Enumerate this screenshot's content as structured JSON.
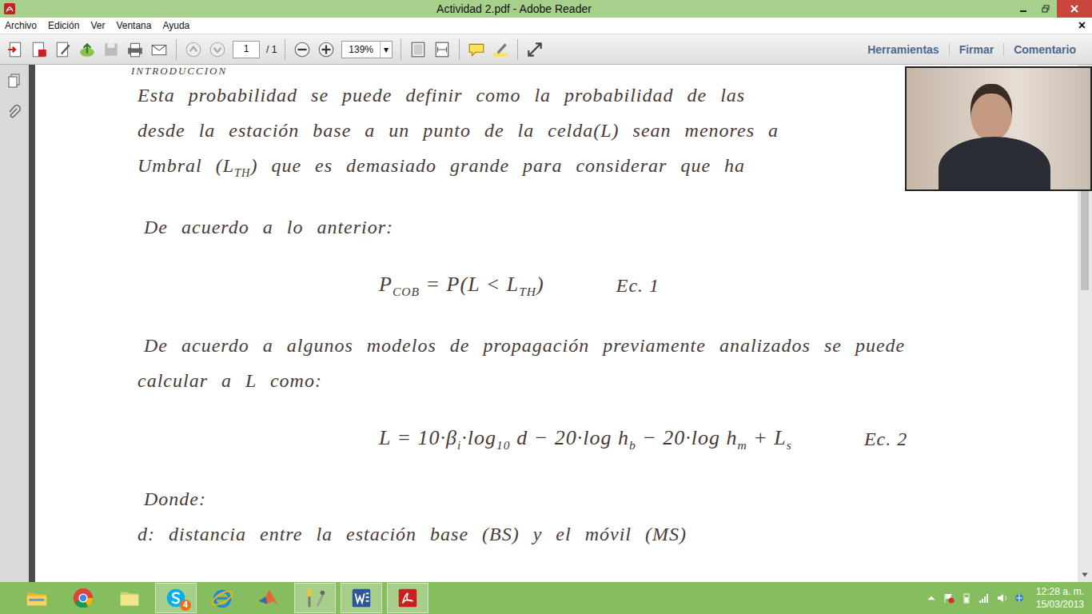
{
  "window": {
    "title": "Actividad 2.pdf - Adobe Reader"
  },
  "menu": {
    "items": [
      "Archivo",
      "Edición",
      "Ver",
      "Ventana",
      "Ayuda"
    ],
    "close": "×"
  },
  "toolbar": {
    "page": "1",
    "page_total": "/ 1",
    "zoom": "139%",
    "zoom_arrow": "▾",
    "tools": [
      "Herramientas",
      "Firmar",
      "Comentario"
    ]
  },
  "document": {
    "lines": [
      {
        "kind": "heading",
        "parts": [
          {
            "text": "INTRODUCCION"
          }
        ]
      },
      {
        "kind": "text",
        "parts": [
          {
            "text": "Esta probabilidad se puede definir como la probabilidad de las"
          }
        ]
      },
      {
        "kind": "text",
        "parts": [
          {
            "text": "desde la estación base a un punto de la celda(L) sean menores a"
          }
        ]
      },
      {
        "kind": "text",
        "parts": [
          {
            "text": "Umbral (L"
          },
          {
            "text": ") que es demasiado grande para considerar que ha",
            "sub_before": "TH"
          }
        ]
      },
      {
        "kind": "paragraph",
        "parts": [
          {
            "text": "De acuerdo a lo anterior:"
          }
        ]
      },
      {
        "kind": "equation",
        "label": "Ec. 1",
        "parts": [
          {
            "text": "P",
            "sub": "COB"
          },
          {
            "text": " = P(L < L",
            "sub": "TH"
          },
          {
            "text": ")"
          }
        ]
      },
      {
        "kind": "paragraph",
        "parts": [
          {
            "text": "De acuerdo a algunos modelos de propagación previamente analizados se puede"
          }
        ]
      },
      {
        "kind": "text",
        "parts": [
          {
            "text": "calcular a L como:"
          }
        ]
      },
      {
        "kind": "equation",
        "label": "Ec. 2",
        "parts": [
          {
            "text": "L = 10·β",
            "sub": "i"
          },
          {
            "text": "·log",
            "sub": "10"
          },
          {
            "text": " d − 20·log h",
            "sub": "b"
          },
          {
            "text": " − 20·log h",
            "sub": "m"
          },
          {
            "text": " + L",
            "sub": "s"
          }
        ]
      },
      {
        "kind": "paragraph",
        "parts": [
          {
            "text": "Donde:"
          }
        ]
      },
      {
        "kind": "text",
        "parts": [
          {
            "text": "d: distancia entre la estación base (BS) y el móvil (MS)"
          }
        ]
      }
    ]
  },
  "taskbar": {
    "apps": [
      {
        "kind": "explorer",
        "active": false,
        "badge": ""
      },
      {
        "kind": "chrome",
        "active": false,
        "badge": ""
      },
      {
        "kind": "folder",
        "active": false,
        "badge": ""
      },
      {
        "kind": "skype",
        "active": true,
        "badge": "4"
      },
      {
        "kind": "ie",
        "active": false,
        "badge": ""
      },
      {
        "kind": "matlab",
        "active": false,
        "badge": ""
      },
      {
        "kind": "tool",
        "active": true,
        "badge": ""
      },
      {
        "kind": "word",
        "active": true,
        "badge": ""
      },
      {
        "kind": "acrobat",
        "active": true,
        "badge": ""
      }
    ],
    "time": "12:28 a. m.",
    "date": "15/03/2013"
  }
}
